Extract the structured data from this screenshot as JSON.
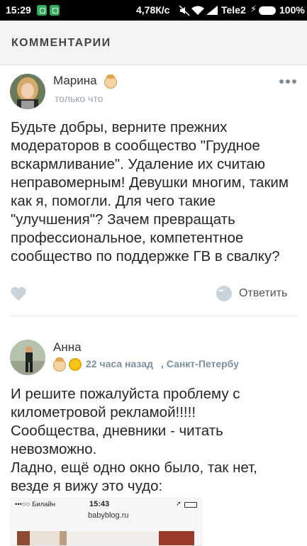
{
  "status_bar": {
    "time": "15:29",
    "speed": "4,78К/с",
    "carrier": "Tele2",
    "battery": "100%"
  },
  "header": {
    "title": "КОММЕНТАРИИ"
  },
  "comments": [
    {
      "author": "Марина",
      "time": "только что",
      "text": "Будьте добры, верните прежних модераторов в сообщество \"Грудное вскармливание\". Удаление их считаю неправомерным! Девушки многим, таким как я, помогли. Для чего такие \"улучшения\"? Зачем превращать профессиональное, компетентное сообщество по поддержке ГВ в свалку?",
      "reply_label": "Ответить"
    },
    {
      "author": "Анна",
      "time": "22 часа назад",
      "location": ", Санкт-Петербу",
      "text_lines": [
        "И решите пожалуйста проблему с",
        "километровой рекламой!!!!!",
        "Сообщества, дневники - читать",
        "невозможно.",
        "Ладно, ещё одно окно было, так нет,",
        "везде я вижу это чудо:"
      ]
    }
  ],
  "embedded_screenshot": {
    "carrier": "•••○○ Билайн",
    "time": "15:43",
    "url": "babyblog.ru"
  },
  "colors": {
    "accent_gray": "#9aa4ad",
    "header_bg": "#f4f4f4",
    "heart": "#c8d3dc"
  }
}
